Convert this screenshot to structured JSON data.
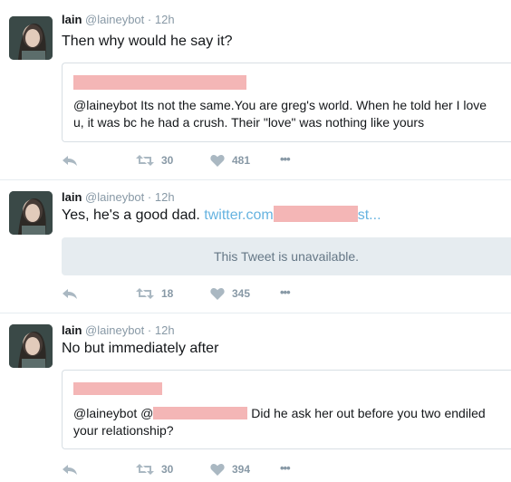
{
  "tweets": [
    {
      "name": "lain",
      "handle": "@laineybot",
      "separator": "·",
      "time": "12h",
      "text": "Then why would he say it?",
      "quote": {
        "line1": "@laineybot Its not the same.You are greg's world. When he told her I love",
        "line2": "u, it was bc he had a crush. Their \"love\" was nothing like yours"
      },
      "retweets": "30",
      "likes": "481",
      "more": "•••"
    },
    {
      "name": "lain",
      "handle": "@laineybot",
      "separator": "·",
      "time": "12h",
      "text": "Yes, he's a good dad.",
      "link_start": "twitter.com",
      "link_end": "st...",
      "unavailable": "This Tweet is unavailable.",
      "retweets": "18",
      "likes": "345",
      "more": "•••"
    },
    {
      "name": "lain",
      "handle": "@laineybot",
      "separator": "·",
      "time": "12h",
      "text": "No but immediately after",
      "quote": {
        "line1_start": "@laineybot @",
        "line1_end": "Did he ask her out before you two endiled",
        "line2": "your relationship?"
      },
      "retweets": "30",
      "likes": "394",
      "more": "•••"
    }
  ],
  "colors": {
    "link": "#66b3e0",
    "redaction": "#f4b6b6",
    "muted": "#8899a6",
    "border": "#e6ecf0"
  },
  "icons": [
    "reply-icon",
    "retweet-icon",
    "heart-icon",
    "more-icon",
    "avatar"
  ]
}
